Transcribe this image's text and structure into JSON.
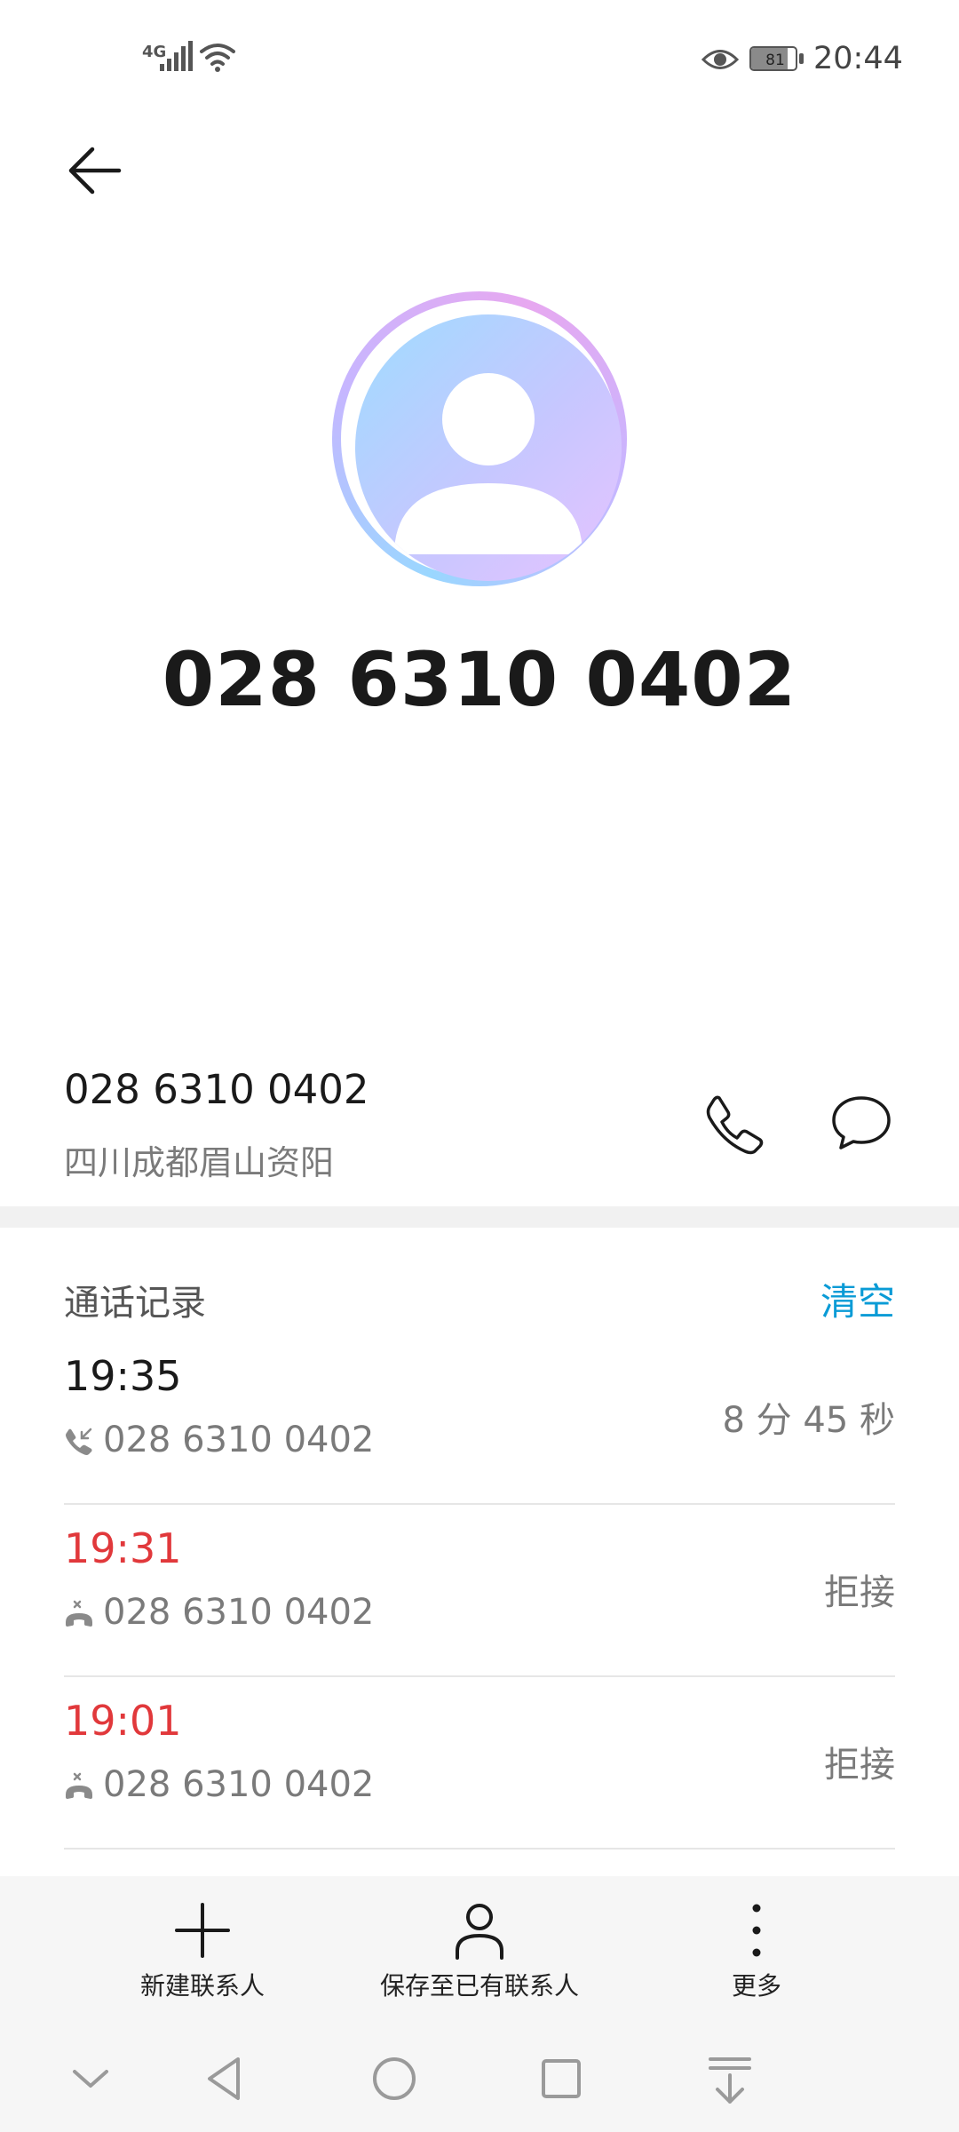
{
  "status_bar": {
    "network": "4G",
    "battery": "81",
    "battery_level": 0.81,
    "time": "20:44"
  },
  "contact": {
    "number": "028 6310 0402",
    "location": "四川成都眉山资阳"
  },
  "call_log": {
    "title": "通话记录",
    "clear_label": "清空",
    "entries": [
      {
        "time": "19:35",
        "number": "028 6310 0402",
        "detail": "8 分 45 秒",
        "type": "incoming",
        "missed": false
      },
      {
        "time": "19:31",
        "number": "028 6310 0402",
        "detail": "拒接",
        "type": "rejected",
        "missed": true
      },
      {
        "time": "19:01",
        "number": "028 6310 0402",
        "detail": "拒接",
        "type": "rejected",
        "missed": true
      }
    ]
  },
  "actions": {
    "new_contact": "新建联系人",
    "save_existing": "保存至已有联系人",
    "more": "更多"
  },
  "icons": {
    "back": "back-arrow-icon",
    "call": "phone-icon",
    "message": "message-bubble-icon",
    "incoming": "incoming-call-icon",
    "rejected": "rejected-call-icon",
    "add": "plus-icon",
    "person": "person-icon",
    "more": "more-vertical-icon"
  },
  "colors": {
    "accent": "#0a9bd6",
    "missed": "#e1383b"
  }
}
